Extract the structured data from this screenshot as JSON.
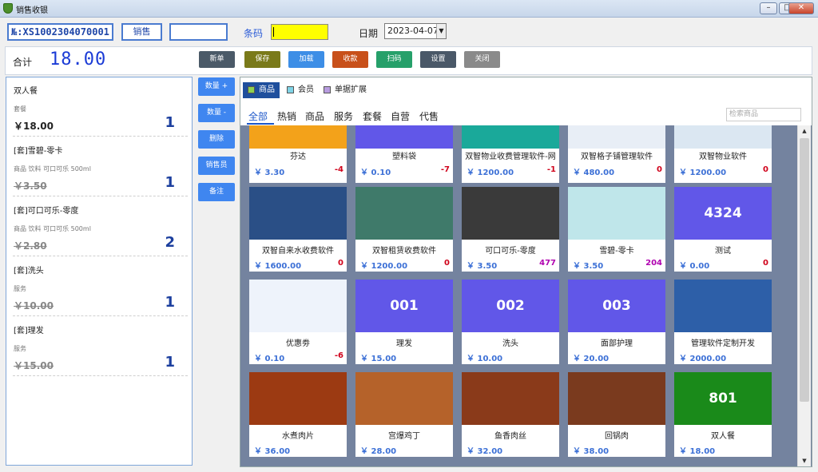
{
  "window": {
    "title": "销售收银"
  },
  "header": {
    "order_no": "№:XS1002304070001",
    "mode_label": "销售",
    "barcode_label": "条码",
    "date_label": "日期",
    "date_value": "2023-04-07"
  },
  "total": {
    "label": "合计",
    "value": "18.00"
  },
  "actions": [
    "新单",
    "保存",
    "加载",
    "收款",
    "扫码",
    "设置",
    "关闭"
  ],
  "side_buttons": [
    "数量 +",
    "数量 -",
    "删除",
    "销售员",
    "备注"
  ],
  "cart": [
    {
      "name": "双人餐",
      "desc": "套餐",
      "price": "￥18.00",
      "qty": "1",
      "struck": false
    },
    {
      "name": "[套]雪碧-零卡",
      "desc": "商品 饮料 可口可乐 500ml",
      "price": "￥3.50",
      "qty": "1",
      "struck": true
    },
    {
      "name": "[套]可口可乐-零度",
      "desc": "商品 饮料 可口可乐 500ml",
      "price": "￥2.80",
      "qty": "2",
      "struck": true
    },
    {
      "name": "[套]洗头",
      "desc": "服务",
      "price": "￥10.00",
      "qty": "1",
      "struck": true
    },
    {
      "name": "[套]理发",
      "desc": "服务",
      "price": "￥15.00",
      "qty": "1",
      "struck": true
    }
  ],
  "categories": [
    {
      "label": "商品",
      "swatch": "#8fd14f",
      "active": true
    },
    {
      "label": "会员",
      "swatch": "#7fd3e6",
      "active": false
    },
    {
      "label": "单据扩展",
      "swatch": "#b89ce0",
      "active": false
    }
  ],
  "filters": [
    "全部",
    "热销",
    "商品",
    "服务",
    "套餐",
    "自营",
    "代售"
  ],
  "search_placeholder": "检索商品",
  "products": [
    {
      "name": "芬达",
      "price": "￥ 3.30",
      "stock": "-4",
      "thumb": "#f3a21a",
      "thumb_text": "",
      "stock_color": "#d0021b"
    },
    {
      "name": "塑料袋",
      "price": "￥ 0.10",
      "stock": "-7",
      "thumb": "#6157e8",
      "thumb_text": "",
      "stock_color": "#d0021b"
    },
    {
      "name": "双智物业收费管理软件-网",
      "price": "￥ 1200.00",
      "stock": "-1",
      "thumb": "#1aa99a",
      "thumb_text": "",
      "stock_color": "#d0021b"
    },
    {
      "name": "双智格子铺管理软件",
      "price": "￥ 480.00",
      "stock": "0",
      "thumb": "#e8eef6",
      "thumb_text": "",
      "stock_color": "#d0021b"
    },
    {
      "name": "双智物业软件",
      "price": "￥ 1200.00",
      "stock": "0",
      "thumb": "#dbe7f2",
      "thumb_text": "",
      "stock_color": "#d0021b"
    },
    {
      "name": "双智自来水收费软件",
      "price": "￥ 1600.00",
      "stock": "0",
      "thumb": "#2a4f86",
      "thumb_text": "",
      "stock_color": "#d0021b"
    },
    {
      "name": "双智租赁收费软件",
      "price": "￥ 1200.00",
      "stock": "0",
      "thumb": "#3f7a6a",
      "thumb_text": "",
      "stock_color": "#d0021b"
    },
    {
      "name": "可口可乐-零度",
      "price": "￥ 3.50",
      "stock": "477",
      "thumb": "#3a3a3a",
      "thumb_text": "",
      "stock_color": "#b000b0"
    },
    {
      "name": "雪碧-零卡",
      "price": "￥ 3.50",
      "stock": "204",
      "thumb": "#bfe6ea",
      "thumb_text": "",
      "stock_color": "#b000b0"
    },
    {
      "name": "测试",
      "price": "￥ 0.00",
      "stock": "0",
      "thumb": "#6157e8",
      "thumb_text": "4324",
      "stock_color": "#d0021b"
    },
    {
      "name": "优惠劵",
      "price": "￥ 0.10",
      "stock": "-6",
      "thumb": "#eef3fb",
      "thumb_text": "",
      "stock_color": "#d0021b"
    },
    {
      "name": "理发",
      "price": "￥ 15.00",
      "stock": "",
      "thumb": "#6157e8",
      "thumb_text": "001",
      "stock_color": "#d0021b"
    },
    {
      "name": "洗头",
      "price": "￥ 10.00",
      "stock": "",
      "thumb": "#6157e8",
      "thumb_text": "002",
      "stock_color": "#d0021b"
    },
    {
      "name": "面部护理",
      "price": "￥ 20.00",
      "stock": "",
      "thumb": "#6157e8",
      "thumb_text": "003",
      "stock_color": "#d0021b"
    },
    {
      "name": "管理软件定制开发",
      "price": "￥ 2000.00",
      "stock": "",
      "thumb": "#2d5fa8",
      "thumb_text": "",
      "stock_color": "#d0021b"
    },
    {
      "name": "水煮肉片",
      "price": "￥ 36.00",
      "stock": "",
      "thumb": "#9c3a12",
      "thumb_text": "",
      "stock_color": "#d0021b"
    },
    {
      "name": "宫爆鸡丁",
      "price": "￥ 28.00",
      "stock": "",
      "thumb": "#b5622a",
      "thumb_text": "",
      "stock_color": "#d0021b"
    },
    {
      "name": "鱼香肉丝",
      "price": "￥ 32.00",
      "stock": "",
      "thumb": "#8a3a1a",
      "thumb_text": "",
      "stock_color": "#d0021b"
    },
    {
      "name": "回锅肉",
      "price": "￥ 38.00",
      "stock": "",
      "thumb": "#7a3a1e",
      "thumb_text": "",
      "stock_color": "#d0021b"
    },
    {
      "name": "双人餐",
      "price": "￥ 18.00",
      "stock": "",
      "thumb": "#1a8a1a",
      "thumb_text": "801",
      "stock_color": "#d0021b"
    }
  ],
  "colors": {
    "new": "#4a5a6a",
    "save": "#7a7a1a",
    "load": "#3d8ee6",
    "pay": "#c8501a",
    "scan": "#26a06a",
    "settings": "#4a5868",
    "close": "#8a8a8a"
  }
}
